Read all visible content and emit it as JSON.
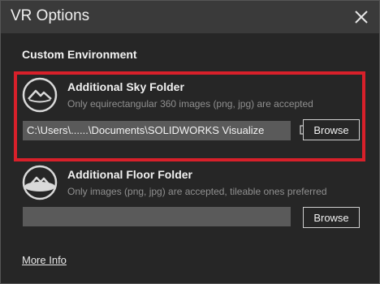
{
  "window": {
    "title": "VR Options"
  },
  "section": {
    "heading": "Custom Environment"
  },
  "sky": {
    "title": "Additional Sky Folder",
    "description": "Only equirectangular 360 images (png, jpg) are accepted",
    "path": "C:\\Users\\......\\Documents\\SOLIDWORKS Visualize",
    "browse_label": "Browse"
  },
  "floor": {
    "title": "Additional Floor Folder",
    "description": "Only images (png, jpg) are accepted, tileable ones preferred",
    "path": "",
    "browse_label": "Browse"
  },
  "footer": {
    "more_info": "More Info"
  },
  "colors": {
    "highlight": "#d8202a",
    "field_bg": "#5a5a5a"
  }
}
